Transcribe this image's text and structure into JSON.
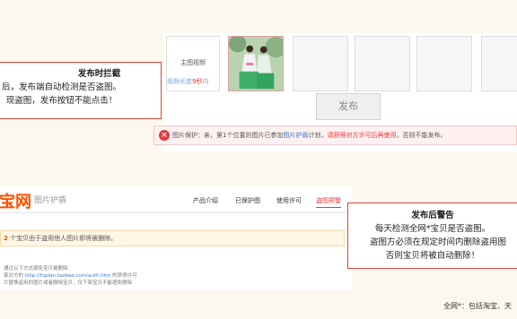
{
  "upload_panel": {
    "video_tile_label": "主图视频",
    "video_caption_prefix": "视频长度",
    "video_caption_value": "9秒",
    "video_caption_suffix": "内"
  },
  "callout_left": {
    "title": "发布时拦截",
    "line1": "后，发布端自动检测是否盗图。",
    "line2": "现盗图，发布按钮不能点击！"
  },
  "publish_button": {
    "label": "发布"
  },
  "warning_bar": {
    "icon": "x-circle-icon",
    "text_a": "图片保护：亲，第1个位置的图片已参加",
    "link": "图片护盾",
    "text_b": "计划，",
    "red_text": "请获得对方许可后再使用",
    "text_c": "，否则不能发布。"
  },
  "site_screenshot": {
    "logo": "宝网",
    "subtitle": "图片护盾",
    "nav": [
      "产品介绍",
      "已保护图",
      "使用许可",
      "盗图预警"
    ],
    "banner_count": "2",
    "banner_text": "个宝贝由于盗用他人图片即将被删除。",
    "small_line1": "通过以下方式避免宝贝被删除：",
    "small_line2_prefix": "家对方的 ",
    "small_line2_link": "http://fuplan.taobao.com/auth.htm",
    "small_line2_suffix": " 的获得许可",
    "small_line3": "片替换盗用的图片或者删除宝贝，仅下架宝贝不能避免删除"
  },
  "callout_right": {
    "title": "发布后警告",
    "line1": "每天检测全网*宝贝是否盗图。",
    "line2": "盗图方必须在规定时间内删除盗用图",
    "line3": "否则宝贝将被自动删除！"
  },
  "footnote": "全网*：包括淘宝、天",
  "colors": {
    "accent_red": "#e4393c",
    "brand_orange": "#ff5000",
    "link_blue": "#3a78c6"
  }
}
